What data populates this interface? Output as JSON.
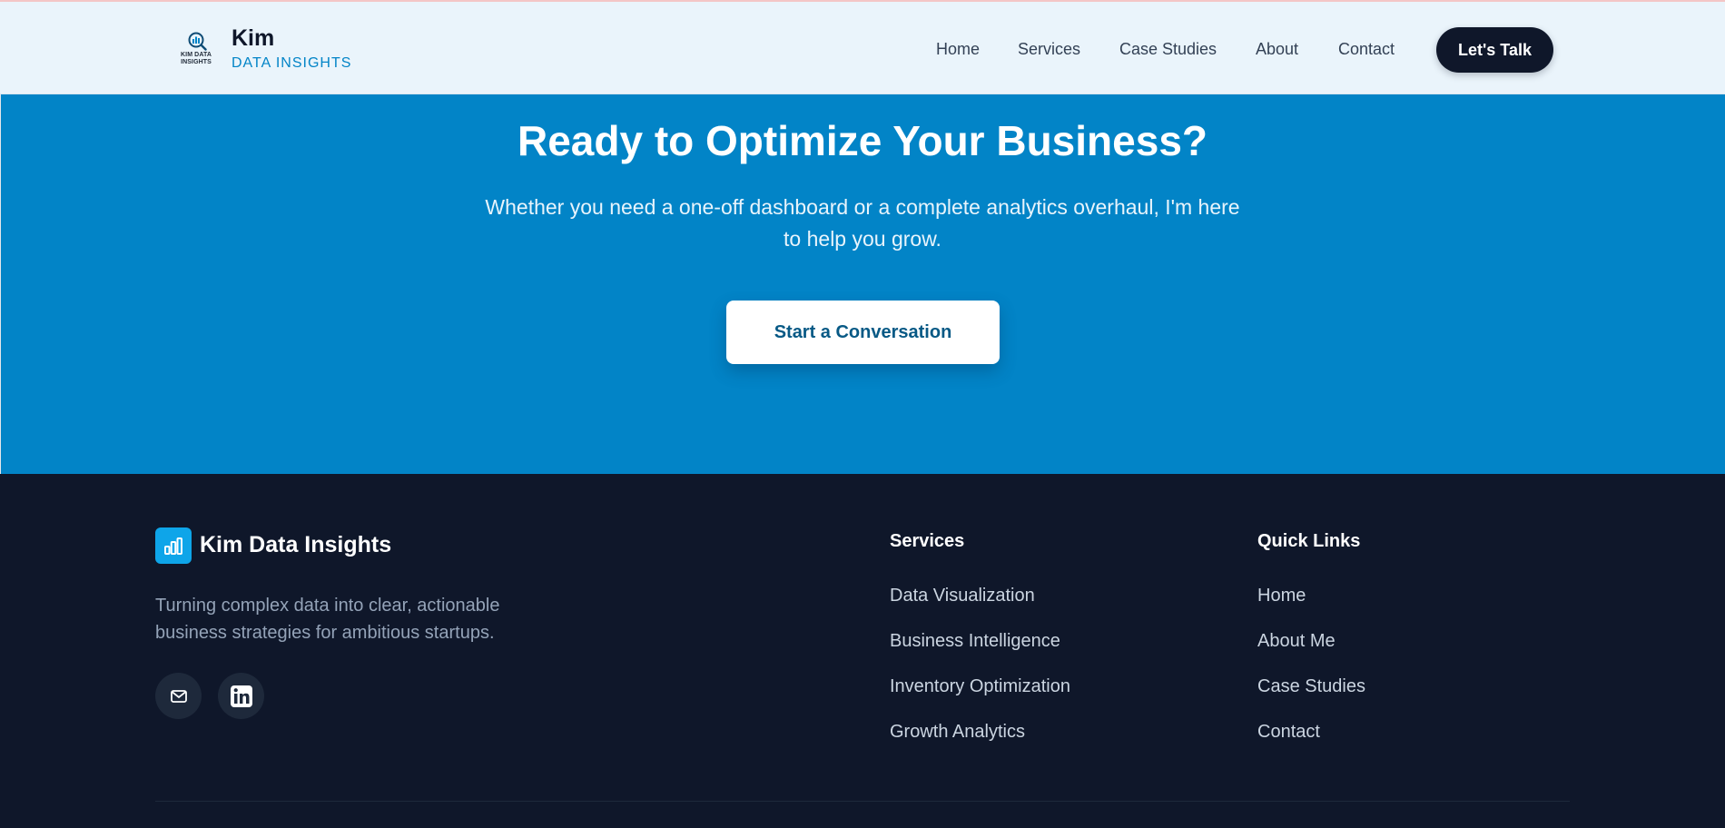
{
  "header": {
    "logo_icon": "magnifier-chart-icon",
    "logo_mini_text": "KIM DATA INSIGHTS",
    "brand_name": "Kim",
    "brand_sub": "DATA INSIGHTS",
    "nav": [
      "Home",
      "Services",
      "Case Studies",
      "About",
      "Contact"
    ],
    "cta_label": "Let's Talk"
  },
  "hero": {
    "title": "Ready to Optimize Your Business?",
    "text": "Whether you need a one-off dashboard or a complete analytics overhaul, I'm here to help you grow.",
    "button_label": "Start a Conversation"
  },
  "footer": {
    "logo_icon": "bar-chart-icon",
    "brand": "Kim Data Insights",
    "description": "Turning complex data into clear, actionable business strategies for ambitious startups.",
    "social": [
      "mail-icon",
      "linkedin-icon"
    ],
    "services": {
      "heading": "Services",
      "links": [
        "Data Visualization",
        "Business Intelligence",
        "Inventory Optimization",
        "Growth Analytics"
      ]
    },
    "quick_links": {
      "heading": "Quick Links",
      "links": [
        "Home",
        "About Me",
        "Case Studies",
        "Contact"
      ]
    }
  },
  "colors": {
    "hero_bg": "#0284c7",
    "footer_bg": "#0f172a",
    "header_bg": "#eaf4fb",
    "accent": "#0ea5e9"
  }
}
